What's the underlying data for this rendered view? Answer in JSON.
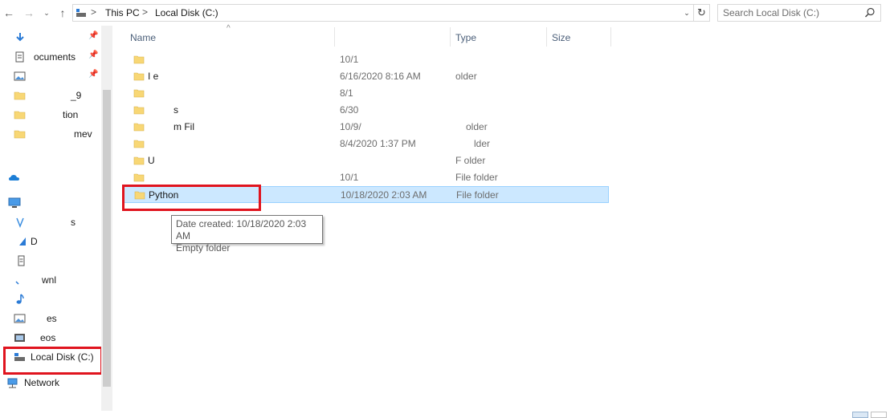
{
  "address_bar": {
    "breadcrumbs": [
      "This PC",
      "Local Disk (C:)"
    ],
    "separator": ">",
    "back_icon": "arrow-left-icon",
    "forward_icon": "arrow-right-icon",
    "recent_icon": "chevron-down-icon",
    "up_icon": "arrow-up-icon",
    "refresh_icon": "refresh-icon"
  },
  "search": {
    "placeholder": "Search Local Disk (C:)"
  },
  "nav_pane": {
    "items": [
      {
        "label": "",
        "icon": "download-arrow-icon",
        "pinned": true
      },
      {
        "label": "ocuments",
        "icon": "document-icon",
        "pinned": true
      },
      {
        "label": "",
        "icon": "picture-icon",
        "pinned": true
      },
      {
        "label": "_9",
        "icon": "folder-icon",
        "pinned": false
      },
      {
        "label": "tion",
        "icon": "folder-icon",
        "pinned": false
      },
      {
        "label": "mev",
        "icon": "folder-icon",
        "pinned": false
      },
      {
        "label": "",
        "icon": "onedrive-cloud-icon",
        "pinned": false
      },
      {
        "label": "",
        "icon": "computer-icon",
        "pinned": false
      },
      {
        "label": "s",
        "icon": "3d-objects-icon",
        "pinned": false
      },
      {
        "label": "D",
        "icon": "desktop-icon",
        "pinned": false
      },
      {
        "label": "",
        "icon": "documents-icon",
        "pinned": false
      },
      {
        "label": "wnl",
        "icon": "downloads-icon",
        "pinned": false
      },
      {
        "label": "",
        "icon": "music-note-icon",
        "pinned": false
      },
      {
        "label": "es",
        "icon": "pictures-icon",
        "pinned": false
      },
      {
        "label": "eos",
        "icon": "videos-icon",
        "pinned": false
      },
      {
        "label": "Local Disk (C:)",
        "icon": "drive-icon",
        "pinned": false
      },
      {
        "label": "Network",
        "icon": "network-icon",
        "pinned": false
      }
    ],
    "pin_glyph": "📌"
  },
  "columns": {
    "name": "Name",
    "date": "",
    "type": "Type",
    "size": "Size"
  },
  "files": [
    {
      "name": "",
      "date": "10/1",
      "type": ""
    },
    {
      "name": "I e",
      "date": "6/16/2020 8:16 AM",
      "type": "older"
    },
    {
      "name": "",
      "date": "8/1",
      "type": ""
    },
    {
      "name": "s",
      "date": "6/30",
      "type": ""
    },
    {
      "name": "m Fil",
      "date": "10/9/",
      "type": "older"
    },
    {
      "name": "",
      "date": "8/4/2020 1:37 PM",
      "type": "lder"
    },
    {
      "name": "U",
      "date": "",
      "type": "F older"
    },
    {
      "name": "",
      "date": "10/1",
      "type": "File folder"
    },
    {
      "name": "Python",
      "date": "10/18/2020 2:03 AM",
      "type": "File folder",
      "selected": true
    }
  ],
  "tooltip": {
    "line1": "Date created: 10/18/2020 2:03 AM",
    "line2": "Empty folder"
  },
  "colors": {
    "folder": "#f8d775",
    "selection": "#cce8ff",
    "highlight_box": "#e0141e",
    "header_text": "#4c607a"
  }
}
